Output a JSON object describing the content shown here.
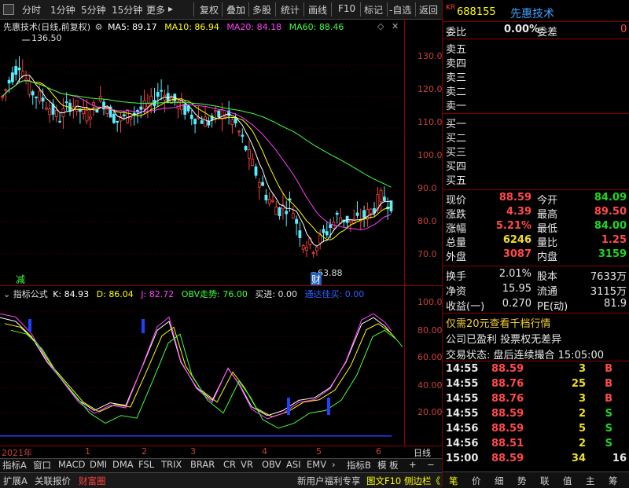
{
  "toolbar": {
    "periods": [
      "分时",
      "1分钟",
      "5分钟",
      "15分钟",
      "更多"
    ],
    "tools": [
      "复权",
      "叠加",
      "多股",
      "统计",
      "画线",
      "F10",
      "标记",
      "-自选",
      "返回"
    ]
  },
  "main_chart": {
    "title": "先惠技术(日线,前复权)",
    "ma5": "MA5: 89.17",
    "ma10": "MA10: 86.94",
    "ma20": "MA20: 84.18",
    "ma60": "MA60: 88.46",
    "high_label": "136.50",
    "low_label": "63.88",
    "ticks": [
      "130.0",
      "120.0",
      "110.0",
      "100.0",
      "90.0",
      "80.0",
      "70.0"
    ],
    "tag_jian": "减",
    "tag_cai": "财",
    "colors": {
      "up": "#ff4040",
      "down": "#54f0ff",
      "ma5": "#ffffff",
      "ma10": "#ffff00",
      "ma20": "#ff40ff",
      "ma60": "#40ff40"
    }
  },
  "indicator": {
    "title": "指标公式",
    "k": "K: 84.93",
    "d": "D: 86.04",
    "j": "J: 82.72",
    "obv": "OBV走势: 76.00",
    "buy": "买进: 0.00",
    "cont": "通达佳买: 0.00",
    "ticks": [
      "100.0",
      "80.00",
      "60.00",
      "40.00",
      "20.00"
    ]
  },
  "time_axis": {
    "labels": [
      "2021年",
      "1",
      "2",
      "3",
      "4",
      "5",
      "6"
    ],
    "right_label": "日线"
  },
  "bottom_tabs": [
    "指标A",
    "窗口",
    "MACD",
    "DMI",
    "DMA",
    "FSL",
    "TRIX",
    "BRAR",
    "CR",
    "VR",
    "OBV",
    "ASI",
    "EMV",
    "指标B",
    "模 板",
    "+",
    "−"
  ],
  "status_bar": {
    "items": [
      "扩展A",
      "关联报价",
      "财富圈"
    ],
    "right_items": [
      "新用户福利专享",
      "图文F10",
      "侧边栏《"
    ]
  },
  "quote_panel": {
    "code": "688155",
    "name": "先惠技术",
    "kr": "KR",
    "webi_label": "委比",
    "webi_value": "0.00%",
    "weicha_label": "委差",
    "weicha_value": "0",
    "sells": [
      "卖五",
      "卖四",
      "卖三",
      "卖二",
      "卖一"
    ],
    "buys": [
      "买一",
      "买二",
      "买三",
      "买四",
      "买五"
    ],
    "stats": [
      {
        "l1": "现价",
        "v1": "88.59",
        "c1": "red",
        "l2": "今开",
        "v2": "84.09",
        "c2": "grn"
      },
      {
        "l1": "涨跌",
        "v1": "4.39",
        "c1": "red",
        "l2": "最高",
        "v2": "89.50",
        "c2": "red"
      },
      {
        "l1": "涨幅",
        "v1": "5.21%",
        "c1": "red",
        "l2": "最低",
        "v2": "84.00",
        "c2": "grn"
      },
      {
        "l1": "总量",
        "v1": "6246",
        "c1": "yel",
        "l2": "量比",
        "v2": "1.25",
        "c2": "red"
      },
      {
        "l1": "外盘",
        "v1": "3087",
        "c1": "red",
        "l2": "内盘",
        "v2": "3159",
        "c2": "grn"
      }
    ],
    "stats2": [
      {
        "l1": "换手",
        "v1": "2.01%",
        "l2": "股本",
        "v2": "7633万"
      },
      {
        "l1": "净资",
        "v1": "15.95",
        "l2": "流通",
        "v2": "3115万"
      },
      {
        "l1": "收益(一)",
        "v1": "0.270",
        "l2": "PE(动)",
        "v2": "81.9"
      }
    ],
    "promo": "仅需20元查看千档行情",
    "promo_amount": "20",
    "notice": "公司已盈利 投票权无差异",
    "trade_state": "交易状态: 盘后连续撮合 15:05:00",
    "ticks": [
      {
        "t": "14:55",
        "p": "88.59",
        "v": "3",
        "s": "B"
      },
      {
        "t": "14:55",
        "p": "88.76",
        "v": "25",
        "s": "B"
      },
      {
        "t": "14:55",
        "p": "88.76",
        "v": "3",
        "s": "B"
      },
      {
        "t": "14:55",
        "p": "88.59",
        "v": "2",
        "s": "S"
      },
      {
        "t": "14:56",
        "p": "88.59",
        "v": "5",
        "s": "S"
      },
      {
        "t": "14:56",
        "p": "88.51",
        "v": "2",
        "s": "S"
      },
      {
        "t": "15:00",
        "p": "88.59",
        "v": "34",
        "s": "16"
      }
    ],
    "bottom_tabs": [
      "笔",
      "价",
      "细",
      "势",
      "联",
      "值",
      "主",
      "筹"
    ]
  }
}
